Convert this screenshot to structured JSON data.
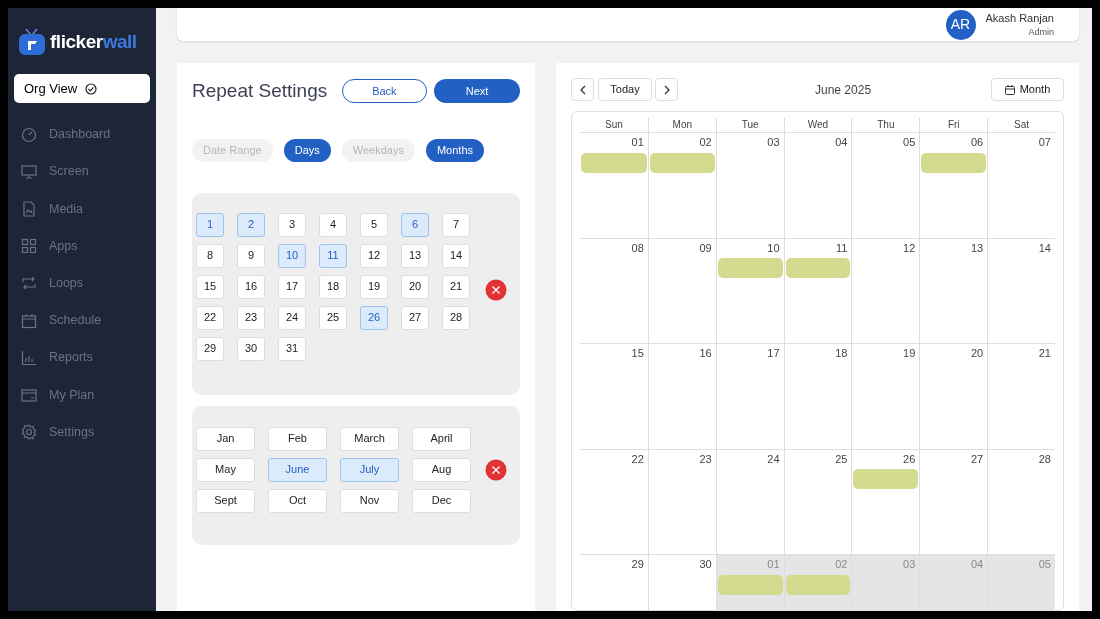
{
  "brand": {
    "name_part1": "flicker",
    "name_part2": "wall"
  },
  "org_view": {
    "label": "Org View"
  },
  "sidebar": {
    "items": [
      {
        "label": "Dashboard",
        "kind": "dashboard"
      },
      {
        "label": "Screen",
        "kind": "screen"
      },
      {
        "label": "Media",
        "kind": "media"
      },
      {
        "label": "Apps",
        "kind": "apps"
      },
      {
        "label": "Loops",
        "kind": "loops"
      },
      {
        "label": "Schedule",
        "kind": "schedule"
      },
      {
        "label": "Reports",
        "kind": "reports"
      },
      {
        "label": "My Plan",
        "kind": "plan"
      },
      {
        "label": "Settings",
        "kind": "settings"
      }
    ]
  },
  "user": {
    "initials": "AR",
    "name": "Akash Ranjan",
    "role": "Admin"
  },
  "repeat": {
    "title": "Repeat Settings",
    "back": "Back",
    "next": "Next",
    "modes": [
      {
        "label": "Date Range",
        "selected": false
      },
      {
        "label": "Days",
        "selected": true
      },
      {
        "label": "Weekdays",
        "selected": false
      },
      {
        "label": "Months",
        "selected": true
      }
    ],
    "days": [
      {
        "label": "1",
        "selected": true
      },
      {
        "label": "2",
        "selected": true
      },
      {
        "label": "3",
        "selected": false
      },
      {
        "label": "4",
        "selected": false
      },
      {
        "label": "5",
        "selected": false
      },
      {
        "label": "6",
        "selected": true
      },
      {
        "label": "7",
        "selected": false
      },
      {
        "label": "8",
        "selected": false
      },
      {
        "label": "9",
        "selected": false
      },
      {
        "label": "10",
        "selected": true
      },
      {
        "label": "11",
        "selected": true
      },
      {
        "label": "12",
        "selected": false
      },
      {
        "label": "13",
        "selected": false
      },
      {
        "label": "14",
        "selected": false
      },
      {
        "label": "15",
        "selected": false
      },
      {
        "label": "16",
        "selected": false
      },
      {
        "label": "17",
        "selected": false
      },
      {
        "label": "18",
        "selected": false
      },
      {
        "label": "19",
        "selected": false
      },
      {
        "label": "20",
        "selected": false
      },
      {
        "label": "21",
        "selected": false
      },
      {
        "label": "22",
        "selected": false
      },
      {
        "label": "23",
        "selected": false
      },
      {
        "label": "24",
        "selected": false
      },
      {
        "label": "25",
        "selected": false
      },
      {
        "label": "26",
        "selected": true
      },
      {
        "label": "27",
        "selected": false
      },
      {
        "label": "28",
        "selected": false
      },
      {
        "label": "29",
        "selected": false
      },
      {
        "label": "30",
        "selected": false
      },
      {
        "label": "31",
        "selected": false
      }
    ],
    "months": [
      {
        "label": "Jan",
        "selected": false
      },
      {
        "label": "Feb",
        "selected": false
      },
      {
        "label": "March",
        "selected": false
      },
      {
        "label": "April",
        "selected": false
      },
      {
        "label": "May",
        "selected": false
      },
      {
        "label": "June",
        "selected": true
      },
      {
        "label": "July",
        "selected": true
      },
      {
        "label": "Aug",
        "selected": false
      },
      {
        "label": "Sept",
        "selected": false
      },
      {
        "label": "Oct",
        "selected": false
      },
      {
        "label": "Nov",
        "selected": false
      },
      {
        "label": "Dec",
        "selected": false
      }
    ]
  },
  "calendar": {
    "today": "Today",
    "title": "June 2025",
    "view": "Month",
    "weekdays": [
      "Sun",
      "Mon",
      "Tue",
      "Wed",
      "Thu",
      "Fri",
      "Sat"
    ],
    "weeks": [
      [
        {
          "label": "01",
          "other_month": false,
          "event": true
        },
        {
          "label": "02",
          "other_month": false,
          "event": true
        },
        {
          "label": "03",
          "other_month": false,
          "event": false
        },
        {
          "label": "04",
          "other_month": false,
          "event": false
        },
        {
          "label": "05",
          "other_month": false,
          "event": false
        },
        {
          "label": "06",
          "other_month": false,
          "event": true
        },
        {
          "label": "07",
          "other_month": false,
          "event": false
        }
      ],
      [
        {
          "label": "08",
          "other_month": false,
          "event": false
        },
        {
          "label": "09",
          "other_month": false,
          "event": false
        },
        {
          "label": "10",
          "other_month": false,
          "event": true
        },
        {
          "label": "11",
          "other_month": false,
          "event": true
        },
        {
          "label": "12",
          "other_month": false,
          "event": false
        },
        {
          "label": "13",
          "other_month": false,
          "event": false
        },
        {
          "label": "14",
          "other_month": false,
          "event": false
        }
      ],
      [
        {
          "label": "15",
          "other_month": false,
          "event": false
        },
        {
          "label": "16",
          "other_month": false,
          "event": false
        },
        {
          "label": "17",
          "other_month": false,
          "event": false
        },
        {
          "label": "18",
          "other_month": false,
          "event": false
        },
        {
          "label": "19",
          "other_month": false,
          "event": false
        },
        {
          "label": "20",
          "other_month": false,
          "event": false
        },
        {
          "label": "21",
          "other_month": false,
          "event": false
        }
      ],
      [
        {
          "label": "22",
          "other_month": false,
          "event": false
        },
        {
          "label": "23",
          "other_month": false,
          "event": false
        },
        {
          "label": "24",
          "other_month": false,
          "event": false
        },
        {
          "label": "25",
          "other_month": false,
          "event": false
        },
        {
          "label": "26",
          "other_month": false,
          "event": true
        },
        {
          "label": "27",
          "other_month": false,
          "event": false
        },
        {
          "label": "28",
          "other_month": false,
          "event": false
        }
      ],
      [
        {
          "label": "29",
          "other_month": false,
          "event": false
        },
        {
          "label": "30",
          "other_month": false,
          "event": false
        },
        {
          "label": "01",
          "other_month": true,
          "event": true
        },
        {
          "label": "02",
          "other_month": true,
          "event": true
        },
        {
          "label": "03",
          "other_month": true,
          "event": false
        },
        {
          "label": "04",
          "other_month": true,
          "event": false
        },
        {
          "label": "05",
          "other_month": true,
          "event": false
        }
      ]
    ]
  }
}
